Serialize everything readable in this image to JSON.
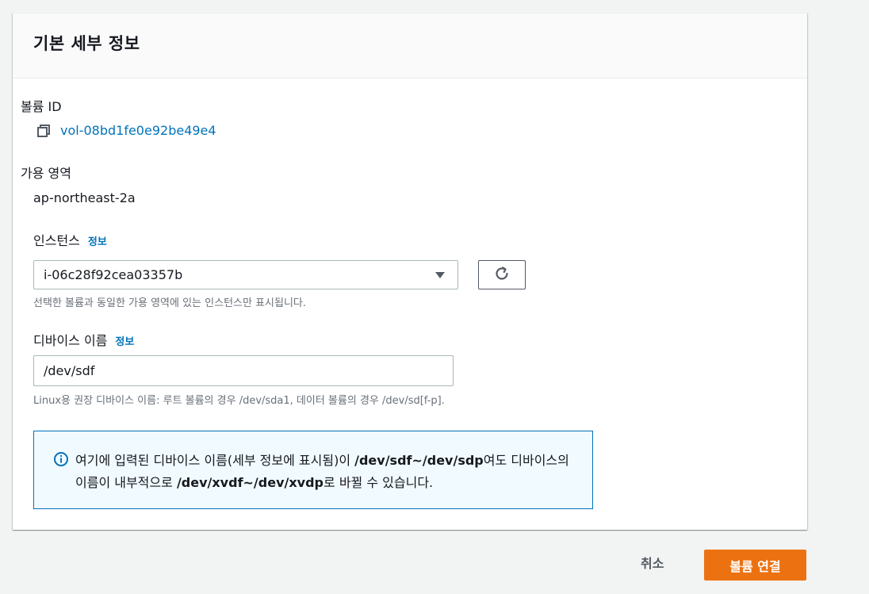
{
  "panel": {
    "title": "기본 세부 정보"
  },
  "volume_id": {
    "label": "볼륨 ID",
    "value": "vol-08bd1fe0e92be49e4",
    "copy_icon": "copy-icon"
  },
  "availability_zone": {
    "label": "가용 영역",
    "value": "ap-northeast-2a"
  },
  "instance": {
    "label": "인스턴스",
    "info_link": "정보",
    "selected": "i-06c28f92cea03357b",
    "hint": "선택한 볼륨과 동일한 가용 영역에 있는 인스턴스만 표시됩니다.",
    "refresh_icon": "refresh-icon"
  },
  "device_name": {
    "label": "디바이스 이름",
    "info_link": "정보",
    "value": "/dev/sdf",
    "hint": "Linux용 권장 디바이스 이름: 루트 볼륨의 경우 /dev/sda1, 데이터 볼륨의 경우 /dev/sd[f-p]."
  },
  "alert": {
    "icon": "info-icon",
    "text_1": "여기에 입력된 디바이스 이름(세부 정보에 표시됨)이 ",
    "bold_1": "/dev/sdf~/dev/sdp",
    "text_2": "여도 디바이스의 이름이 내부적으로 ",
    "bold_2": "/dev/xvdf~/dev/xvdp",
    "text_3": "로 바뀔 수 있습니다."
  },
  "footer": {
    "cancel_label": "취소",
    "submit_label": "볼륨 연결"
  },
  "colors": {
    "link": "#0073bb",
    "primary": "#ec7211",
    "alert_bg": "#f1faff",
    "alert_border": "#0073bb"
  }
}
